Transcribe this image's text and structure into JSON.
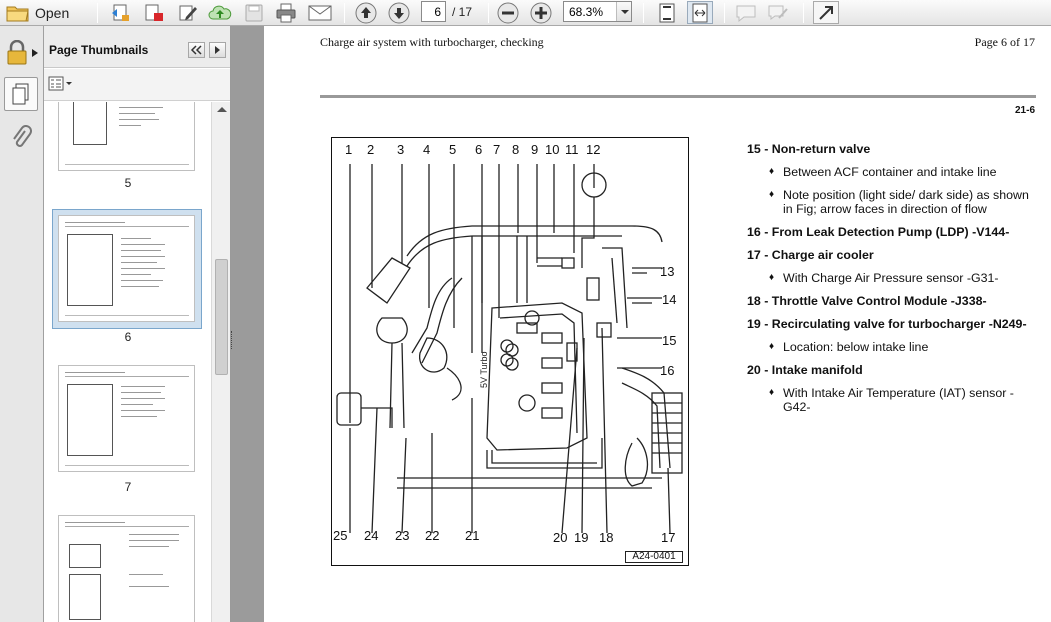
{
  "toolbar": {
    "open_label": "Open",
    "page_current": "6",
    "page_total": "/ 17",
    "zoom": "68.3%"
  },
  "panel": {
    "title": "Page Thumbnails"
  },
  "thumbnails": [
    {
      "label": "5"
    },
    {
      "label": "6",
      "selected": true
    },
    {
      "label": "7"
    },
    {
      "label": ""
    }
  ],
  "document": {
    "header_left": "Charge air system with turbocharger, checking",
    "header_right": "Page 6 of 17",
    "section_number": "21-6",
    "figure_id": "A24-0401",
    "figure_top_labels": [
      "1",
      "2",
      "3",
      "4",
      "5",
      "6",
      "7",
      "8",
      "9",
      "10",
      "11",
      "12"
    ],
    "figure_right_labels": [
      "13",
      "14",
      "15",
      "16"
    ],
    "figure_bottom_labels": [
      "25",
      "24",
      "23",
      "22",
      "21",
      "20",
      "19",
      "18",
      "17"
    ],
    "legend": [
      {
        "label": "15 - Non-return valve",
        "subs": [
          "Between ACF container and intake line",
          "Note position (light side/ dark side) as shown in Fig; arrow faces in direction of flow"
        ]
      },
      {
        "label": "16 - From Leak Detection Pump (LDP) -V144-",
        "subs": []
      },
      {
        "label": "17 - Charge air cooler",
        "subs": [
          "With Charge Air Pressure sensor -G31-"
        ]
      },
      {
        "label": "18 - Throttle Valve Control Module -J338-",
        "subs": []
      },
      {
        "label": "19 - Recirculating valve for turbocharger -N249-",
        "subs": [
          "Location: below intake line"
        ]
      },
      {
        "label": "20 - Intake manifold",
        "subs": [
          "With Intake Air Temperature (IAT) sensor -G42-"
        ]
      }
    ]
  }
}
